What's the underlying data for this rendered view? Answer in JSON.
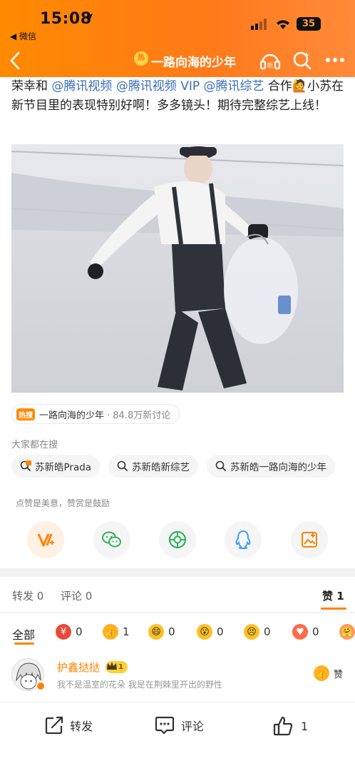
{
  "status_bar": {
    "time": "15:08",
    "back_app": "◀ 微信",
    "battery": "35"
  },
  "nav": {
    "title": "一路向海的少年",
    "title_tag": "热"
  },
  "post": {
    "text_prefix": "荣幸和 ",
    "mention1": "@腾讯视频",
    "mention2": "@腾讯视频 VIP",
    "mention3": "@腾讯综艺",
    "text_suffix": " 合作🙋小苏在新节目里的表现特别好啊！多多镜头！期待完整综艺上线！"
  },
  "topic": {
    "tag": "热搜",
    "name": "一路向海的少年",
    "stats": "· 84.8万新讨论"
  },
  "search": {
    "label": "大家都在搜",
    "items": [
      {
        "text": "苏新皓Prada",
        "hot": true
      },
      {
        "text": "苏新皓新综艺",
        "hot": false
      },
      {
        "text": "苏新皓一路向海的少年",
        "hot": false
      }
    ]
  },
  "praise_hint": "点赞是美意，赞赏是鼓励",
  "share_icons": [
    "reward-v-icon",
    "wechat-icon",
    "moments-icon",
    "qq-icon",
    "save-image-icon"
  ],
  "tabs": {
    "repost": "转发 0",
    "comment": "评论 0",
    "like": "赞 1"
  },
  "reactions": {
    "all_label": "全部",
    "items": [
      {
        "name": "money-emoji-icon",
        "count": "0",
        "color": "#e84a3a"
      },
      {
        "name": "thumbs-up-emoji-icon",
        "count": "1",
        "color": "#ffb020"
      },
      {
        "name": "laugh-emoji-icon",
        "count": "0",
        "color": "#ffc020"
      },
      {
        "name": "surprised-emoji-icon",
        "count": "0",
        "color": "#ffc020"
      },
      {
        "name": "sad-emoji-icon",
        "count": "0",
        "color": "#ffc020"
      },
      {
        "name": "heart-emoji-icon",
        "count": "0",
        "color": "#ff6a4a"
      }
    ]
  },
  "liker": {
    "name": "护鑫挞挞",
    "level": "1",
    "bio": "我不是温室的花朵 我是在荆棘里开出的野性",
    "like_label": "赞"
  },
  "bottom_bar": {
    "repost": "转发",
    "comment": "评论",
    "like": "1"
  },
  "colors": {
    "brand_orange": "#ff8200",
    "mention_blue": "#3a6fb5"
  }
}
